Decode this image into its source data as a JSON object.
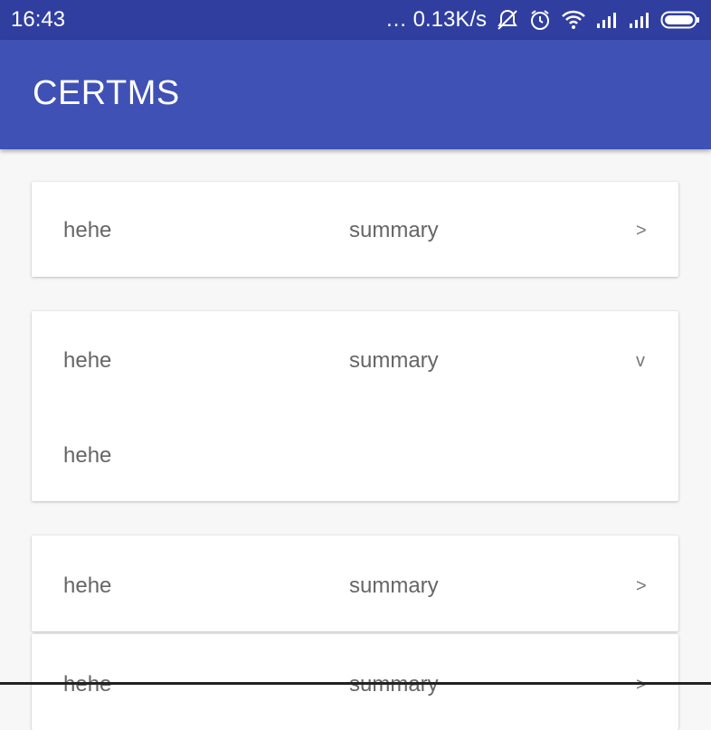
{
  "status_bar": {
    "time": "16:43",
    "network_speed": "… 0.13K/s",
    "icons": [
      "notification-mute-icon",
      "alarm-icon",
      "wifi-icon",
      "signal-icon",
      "signal-icon",
      "battery-icon"
    ]
  },
  "app_bar": {
    "title": "CERTMS",
    "color": "#3f51b5"
  },
  "list": {
    "items": [
      {
        "title": "hehe",
        "summary": "summary",
        "indicator": ">",
        "expanded": false
      },
      {
        "title": "hehe",
        "summary": "summary",
        "indicator": "v",
        "expanded": true,
        "detail": "hehe"
      },
      {
        "title": "hehe",
        "summary": "summary",
        "indicator": ">",
        "expanded": false
      },
      {
        "title": "hehe",
        "summary": "summary",
        "indicator": ">",
        "expanded": false
      }
    ]
  }
}
